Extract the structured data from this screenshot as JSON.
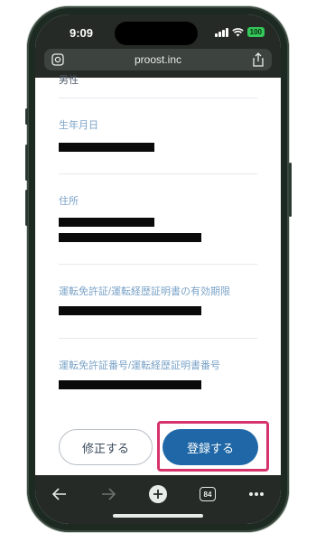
{
  "status_bar": {
    "time": "9:09",
    "battery": "100"
  },
  "browser": {
    "url": "proost.inc",
    "tab_count": "84"
  },
  "form": {
    "partial_label": "男性",
    "fields": [
      {
        "label": "生年月日"
      },
      {
        "label": "住所"
      },
      {
        "label": "運転免許証/運転経歴証明書の有効期限"
      },
      {
        "label": "運転免許証番号/運転経歴証明書番号"
      }
    ]
  },
  "actions": {
    "fix_label": "修正する",
    "register_label": "登録する"
  },
  "colors": {
    "accent": "#1f67a6",
    "highlight": "#d6336c",
    "label": "#7aa3c8"
  },
  "icons": [
    "lens-icon",
    "share-icon",
    "back-icon",
    "forward-icon",
    "new-tab-icon",
    "tabs-icon",
    "more-icon"
  ]
}
